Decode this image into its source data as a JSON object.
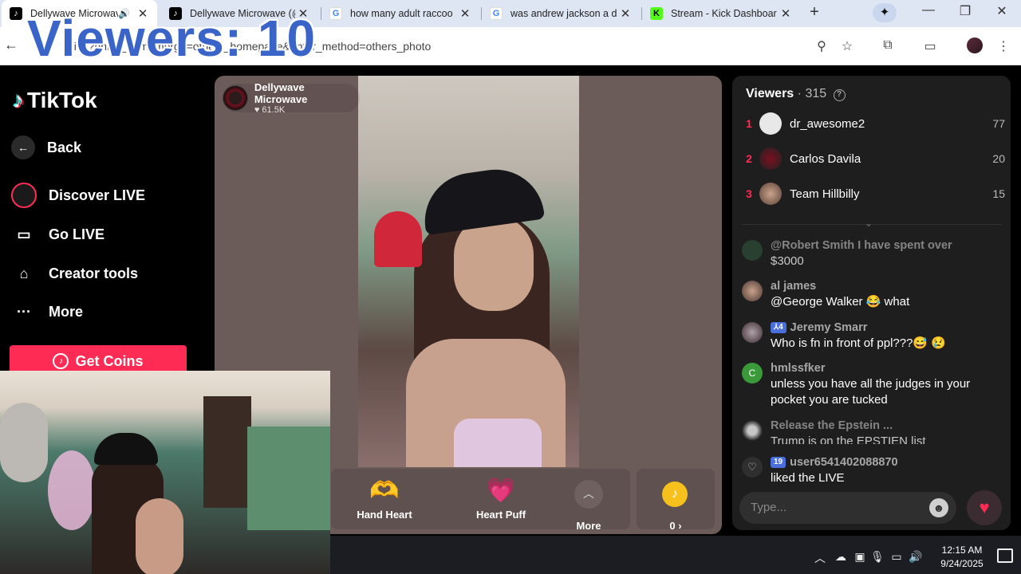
{
  "browser": {
    "tabs": [
      {
        "title": "Dellywave Microwav",
        "favicon": "tiktok-icon",
        "active": true,
        "audio": true
      },
      {
        "title": "Dellywave Microwave (@",
        "favicon": "tiktok-icon"
      },
      {
        "title": "how many adult raccoo",
        "favicon": "google-icon"
      },
      {
        "title": "was andrew jackson a d",
        "favicon": "google-icon"
      },
      {
        "title": "Stream - Kick Dashboar",
        "favicon": "kick-icon"
      }
    ],
    "url": "...live?enter_from_merge=others_homepage&enter_method=others_photo"
  },
  "overlay": {
    "viewers_text": "Viewers: 10"
  },
  "sidebar": {
    "brand": "TikTok",
    "items": [
      {
        "label": "Back",
        "icon": "arrow-left-icon"
      },
      {
        "label": "Discover LIVE",
        "icon": "live-avatar-icon"
      },
      {
        "label": "Go LIVE",
        "icon": "camera-icon"
      },
      {
        "label": "Creator tools",
        "icon": "creator-tools-icon"
      },
      {
        "label": "More",
        "icon": "dots-icon"
      }
    ],
    "get_coins": "Get Coins"
  },
  "stream": {
    "host_name": "Dellywave Microwave",
    "host_likes": "61.5K"
  },
  "gifts": [
    {
      "name": "Hand Heart",
      "icon": "🫶"
    },
    {
      "name": "Heart Puff",
      "icon": "💗"
    }
  ],
  "gift_more": "More",
  "coin_balance": "0 ›",
  "chat": {
    "viewers_label": "Viewers",
    "viewers_count": "315",
    "top_viewers": [
      {
        "rank": "1",
        "name": "dr_awesome2",
        "score": "77"
      },
      {
        "rank": "2",
        "name": "Carlos Davila",
        "score": "20"
      },
      {
        "rank": "3",
        "name": "Team Hillbilly",
        "score": "15"
      }
    ],
    "messages": [
      {
        "user": "@Robert Smith I have spent over",
        "text": "$3000",
        "badge": ""
      },
      {
        "user": "al james",
        "text": "@George Walker 😂 what",
        "badge": ""
      },
      {
        "user": "Jeremy Smarr",
        "text": "Who is fn in front of ppl???😅 😢",
        "badge": "⅄4"
      },
      {
        "user": "hmlssfker",
        "text": "unless you have all the judges in your pocket you are tucked",
        "badge": ""
      },
      {
        "user": "Release the Epstein ...",
        "text": "Trump is on the EPSTIEN list",
        "badge": ""
      },
      {
        "user": "user6541402088870",
        "text": "liked the LIVE",
        "badge": "19"
      }
    ],
    "input_placeholder": "Type..."
  },
  "taskbar": {
    "time": "12:15 AM",
    "date": "9/24/2025"
  },
  "colors": {
    "tiktok_pink": "#fe2c55",
    "chat_bg": "#1e1e1e",
    "overlay_text": "#3a64c8"
  }
}
